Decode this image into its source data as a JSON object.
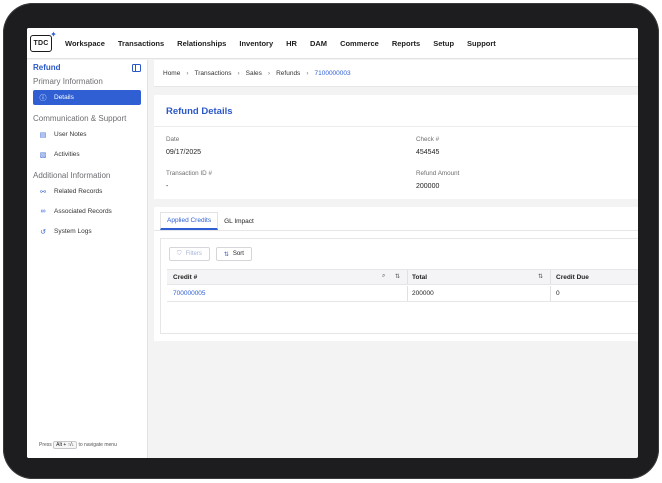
{
  "app": {
    "logo_text": "TDC"
  },
  "nav": {
    "items": [
      "Workspace",
      "Transactions",
      "Relationships",
      "Inventory",
      "HR",
      "DAM",
      "Commerce",
      "Reports",
      "Setup",
      "Support"
    ]
  },
  "sidebar": {
    "title": "Refund",
    "sections": [
      {
        "label": "Primary Information",
        "items": [
          {
            "label": "Details",
            "icon": "info-icon",
            "active": true
          }
        ]
      },
      {
        "label": "Communication & Support",
        "items": [
          {
            "label": "User Notes",
            "icon": "note-icon"
          },
          {
            "label": "Activities",
            "icon": "document-icon"
          }
        ]
      },
      {
        "label": "Additional Information",
        "items": [
          {
            "label": "Related Records",
            "icon": "link-icon"
          },
          {
            "label": "Associated Records",
            "icon": "share-icon"
          },
          {
            "label": "System Logs",
            "icon": "history-icon"
          }
        ]
      }
    ],
    "hint": {
      "prefix": "Press",
      "keys": "Alt + ↑/↓",
      "suffix": "to navigate menu"
    }
  },
  "breadcrumb": {
    "items": [
      "Home",
      "Transactions",
      "Sales",
      "Refunds"
    ],
    "current": "7100000003"
  },
  "details": {
    "title": "Refund Details",
    "fields": [
      {
        "label": "Date",
        "value": "09/17/2025"
      },
      {
        "label": "Check #",
        "value": "454545"
      },
      {
        "label": "Transaction ID #",
        "value": "-"
      },
      {
        "label": "Refund Amount",
        "value": "200000"
      }
    ]
  },
  "tabs": {
    "items": [
      "Applied Credits",
      "GL Impact"
    ],
    "active": 0
  },
  "table": {
    "filters_label": "Filters",
    "sort_label": "Sort",
    "columns": [
      "Credit #",
      "Total",
      "Credit Due"
    ],
    "rows": [
      {
        "credit": "700000005",
        "total": "200000",
        "due": "0"
      }
    ]
  },
  "colors": {
    "accent": "#2f5fd3",
    "device": "#1d1d1f",
    "background": "#f3f3f4"
  }
}
